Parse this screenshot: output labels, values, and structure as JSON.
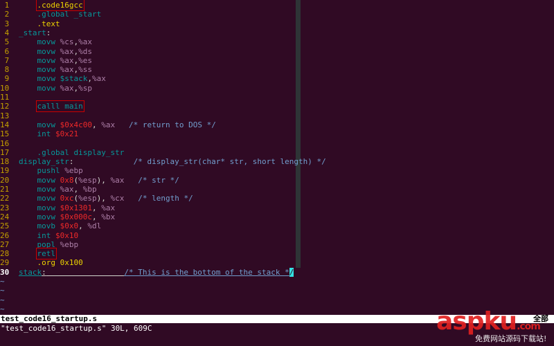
{
  "editor": {
    "lines": [
      {
        "num": "1",
        "segs": [
          {
            "t": "    "
          },
          {
            "t": ".code16",
            "c": "t-orange",
            "box": true
          },
          {
            "t": "gcc",
            "c": "t-orange",
            "box": true
          }
        ]
      },
      {
        "num": "2",
        "segs": [
          {
            "t": "    "
          },
          {
            "t": ".global _start",
            "c": "t-cyan"
          }
        ]
      },
      {
        "num": "3",
        "segs": [
          {
            "t": "    "
          },
          {
            "t": ".text",
            "c": "t-orange"
          }
        ]
      },
      {
        "num": "4",
        "segs": [
          {
            "t": "_start",
            "c": "t-cyan"
          },
          {
            "t": ":",
            "c": "t-white"
          }
        ]
      },
      {
        "num": "5",
        "segs": [
          {
            "t": "    "
          },
          {
            "t": "movw ",
            "c": "t-cyan"
          },
          {
            "t": "%cs",
            "c": "t-purple"
          },
          {
            "t": ",",
            "c": "t-white"
          },
          {
            "t": "%ax",
            "c": "t-purple"
          }
        ]
      },
      {
        "num": "6",
        "segs": [
          {
            "t": "    "
          },
          {
            "t": "movw ",
            "c": "t-cyan"
          },
          {
            "t": "%ax",
            "c": "t-purple"
          },
          {
            "t": ",",
            "c": "t-white"
          },
          {
            "t": "%ds",
            "c": "t-purple"
          }
        ]
      },
      {
        "num": "7",
        "segs": [
          {
            "t": "    "
          },
          {
            "t": "movw ",
            "c": "t-cyan"
          },
          {
            "t": "%ax",
            "c": "t-purple"
          },
          {
            "t": ",",
            "c": "t-white"
          },
          {
            "t": "%es",
            "c": "t-purple"
          }
        ]
      },
      {
        "num": "8",
        "segs": [
          {
            "t": "    "
          },
          {
            "t": "movw ",
            "c": "t-cyan"
          },
          {
            "t": "%ax",
            "c": "t-purple"
          },
          {
            "t": ",",
            "c": "t-white"
          },
          {
            "t": "%ss",
            "c": "t-purple"
          }
        ]
      },
      {
        "num": "9",
        "segs": [
          {
            "t": "    "
          },
          {
            "t": "movw ",
            "c": "t-cyan"
          },
          {
            "t": "$stack",
            "c": "t-cyan"
          },
          {
            "t": ",",
            "c": "t-white"
          },
          {
            "t": "%ax",
            "c": "t-purple"
          }
        ]
      },
      {
        "num": "10",
        "segs": [
          {
            "t": "    "
          },
          {
            "t": "movw ",
            "c": "t-cyan"
          },
          {
            "t": "%ax",
            "c": "t-purple"
          },
          {
            "t": ",",
            "c": "t-white"
          },
          {
            "t": "%sp",
            "c": "t-purple"
          }
        ]
      },
      {
        "num": "11",
        "segs": []
      },
      {
        "num": "12",
        "segs": [
          {
            "t": "    "
          },
          {
            "t": "calll main",
            "c": "t-cyan",
            "box": true
          }
        ]
      },
      {
        "num": "13",
        "segs": []
      },
      {
        "num": "14",
        "segs": [
          {
            "t": "    "
          },
          {
            "t": "movw ",
            "c": "t-cyan"
          },
          {
            "t": "$0x4c00",
            "c": "t-num"
          },
          {
            "t": ", ",
            "c": "t-white"
          },
          {
            "t": "%ax",
            "c": "t-purple"
          },
          {
            "t": "   "
          },
          {
            "t": "/* return to DOS */",
            "c": "t-comment"
          }
        ]
      },
      {
        "num": "15",
        "segs": [
          {
            "t": "    "
          },
          {
            "t": "int ",
            "c": "t-cyan"
          },
          {
            "t": "$0x21",
            "c": "t-num"
          }
        ]
      },
      {
        "num": "16",
        "segs": []
      },
      {
        "num": "17",
        "segs": [
          {
            "t": "    "
          },
          {
            "t": ".global display_str",
            "c": "t-cyan"
          }
        ]
      },
      {
        "num": "18",
        "segs": [
          {
            "t": "display_str",
            "c": "t-cyan"
          },
          {
            "t": ":",
            "c": "t-white"
          },
          {
            "t": "             "
          },
          {
            "t": "/* display_str(char* str, short length) */",
            "c": "t-comment"
          }
        ]
      },
      {
        "num": "19",
        "segs": [
          {
            "t": "    "
          },
          {
            "t": "pushl ",
            "c": "t-cyan"
          },
          {
            "t": "%ebp",
            "c": "t-purple"
          }
        ]
      },
      {
        "num": "20",
        "segs": [
          {
            "t": "    "
          },
          {
            "t": "movw ",
            "c": "t-cyan"
          },
          {
            "t": "0x8",
            "c": "t-num"
          },
          {
            "t": "(",
            "c": "t-white"
          },
          {
            "t": "%esp",
            "c": "t-purple"
          },
          {
            "t": "), ",
            "c": "t-white"
          },
          {
            "t": "%ax",
            "c": "t-purple"
          },
          {
            "t": "   "
          },
          {
            "t": "/* str */",
            "c": "t-comment"
          }
        ]
      },
      {
        "num": "21",
        "segs": [
          {
            "t": "    "
          },
          {
            "t": "movw ",
            "c": "t-cyan"
          },
          {
            "t": "%ax",
            "c": "t-purple"
          },
          {
            "t": ", ",
            "c": "t-white"
          },
          {
            "t": "%bp",
            "c": "t-purple"
          }
        ]
      },
      {
        "num": "22",
        "segs": [
          {
            "t": "    "
          },
          {
            "t": "movw ",
            "c": "t-cyan"
          },
          {
            "t": "0xc",
            "c": "t-num"
          },
          {
            "t": "(",
            "c": "t-white"
          },
          {
            "t": "%esp",
            "c": "t-purple"
          },
          {
            "t": "), ",
            "c": "t-white"
          },
          {
            "t": "%cx",
            "c": "t-purple"
          },
          {
            "t": "   "
          },
          {
            "t": "/* length */",
            "c": "t-comment"
          }
        ]
      },
      {
        "num": "23",
        "segs": [
          {
            "t": "    "
          },
          {
            "t": "movw ",
            "c": "t-cyan"
          },
          {
            "t": "$0x1301",
            "c": "t-num"
          },
          {
            "t": ", ",
            "c": "t-white"
          },
          {
            "t": "%ax",
            "c": "t-purple"
          }
        ]
      },
      {
        "num": "24",
        "segs": [
          {
            "t": "    "
          },
          {
            "t": "movw ",
            "c": "t-cyan"
          },
          {
            "t": "$0x000c",
            "c": "t-num"
          },
          {
            "t": ", ",
            "c": "t-white"
          },
          {
            "t": "%bx",
            "c": "t-purple"
          }
        ]
      },
      {
        "num": "25",
        "segs": [
          {
            "t": "    "
          },
          {
            "t": "movb ",
            "c": "t-cyan"
          },
          {
            "t": "$0x0",
            "c": "t-num"
          },
          {
            "t": ", ",
            "c": "t-white"
          },
          {
            "t": "%dl",
            "c": "t-purple"
          }
        ]
      },
      {
        "num": "26",
        "segs": [
          {
            "t": "    "
          },
          {
            "t": "int ",
            "c": "t-cyan"
          },
          {
            "t": "$0x10",
            "c": "t-num"
          }
        ]
      },
      {
        "num": "27",
        "segs": [
          {
            "t": "    "
          },
          {
            "t": "popl ",
            "c": "t-cyan"
          },
          {
            "t": "%ebp",
            "c": "t-purple"
          }
        ]
      },
      {
        "num": "28",
        "segs": [
          {
            "t": "    "
          },
          {
            "t": "retl",
            "c": "t-cyan",
            "box": true
          }
        ]
      },
      {
        "num": "29",
        "segs": [
          {
            "t": "    "
          },
          {
            "t": ".org 0x100",
            "c": "t-orange"
          }
        ]
      },
      {
        "num": "30",
        "current": true,
        "segs": [
          {
            "t": "stack",
            "c": "t-cyan",
            "u": true
          },
          {
            "t": ":",
            "c": "t-white",
            "u": true
          },
          {
            "t": "                 ",
            "u": true
          },
          {
            "t": "/* This is the bottom of the stack *",
            "c": "t-comment",
            "u": true
          },
          {
            "t": "/",
            "c": "t-comment",
            "cursor": true
          }
        ]
      }
    ],
    "tilde": "~",
    "tilde_count": 4
  },
  "status_bar": {
    "filename": "test_code16_startup.s",
    "position": "全部"
  },
  "message_line": "\"test_code16_startup.s\" 30L, 609C",
  "watermark": {
    "brand": "aspku",
    "domain_text": ".com",
    "tagline": "免费网站源码下载站!"
  },
  "colors": {
    "background": "#300a24",
    "line_number": "#c4a000",
    "highlight_box": "#cc0000"
  }
}
